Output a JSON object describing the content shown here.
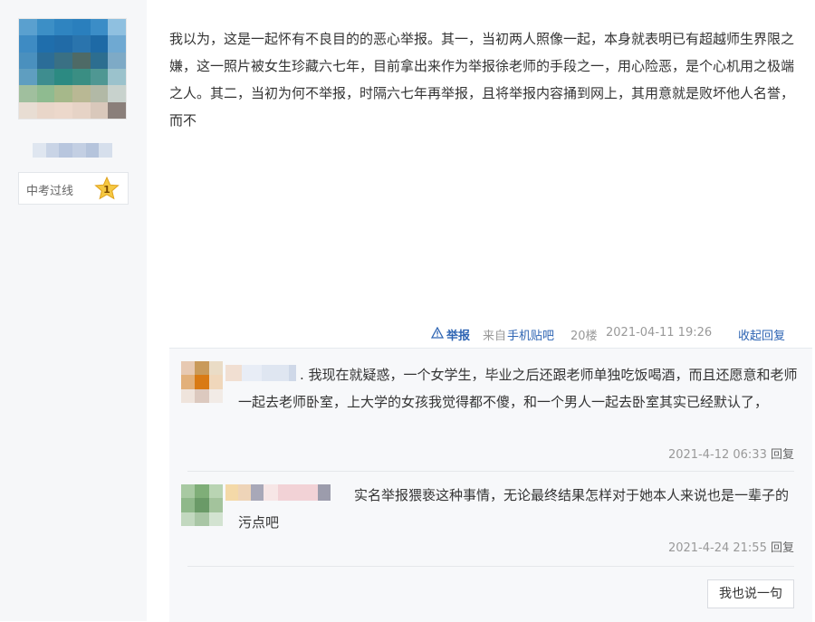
{
  "author": {
    "level_name": "中考过线",
    "level_number": "1",
    "star_color": "#f2b928"
  },
  "post": {
    "content": "我以为，这是一起怀有不良目的的恶心举报。其一，当初两人照像一起，本身就表明已有超越师生界限之嫌，这一照片被女生珍藏六七年，目前拿出来作为举报徐老师的手段之一，用心险恶，是个心机用之极端之人。其二，当初为何不举报，时隔六七年再举报，且将举报内容捅到网上，其用意就是败坏他人名誉，而不"
  },
  "meta": {
    "report_label": "举报",
    "source_prefix": "来自",
    "source_link": "手机贴吧",
    "floor": "20楼",
    "timestamp": "2021-04-11 19:26",
    "collapse_label": "收起回复",
    "link_color": "#2d64b3"
  },
  "replies": [
    {
      "text": ". 我现在就疑惑，一个女学生，毕业之后还跟老师单独吃饭喝酒，而且还愿意和老师一起去老师卧室，上大学的女孩我觉得都不傻，和一个男人一起去卧室其实已经默认了，",
      "time": "2021-4-12 06:33",
      "reply_label": "回复"
    },
    {
      "text": "实名举报猥亵这种事情，无论最终结果怎样对于她本人来说也是一辈子的污点吧",
      "time": "2021-4-24 21:55",
      "reply_label": "回复"
    }
  ],
  "say_button_label": "我也说一句"
}
